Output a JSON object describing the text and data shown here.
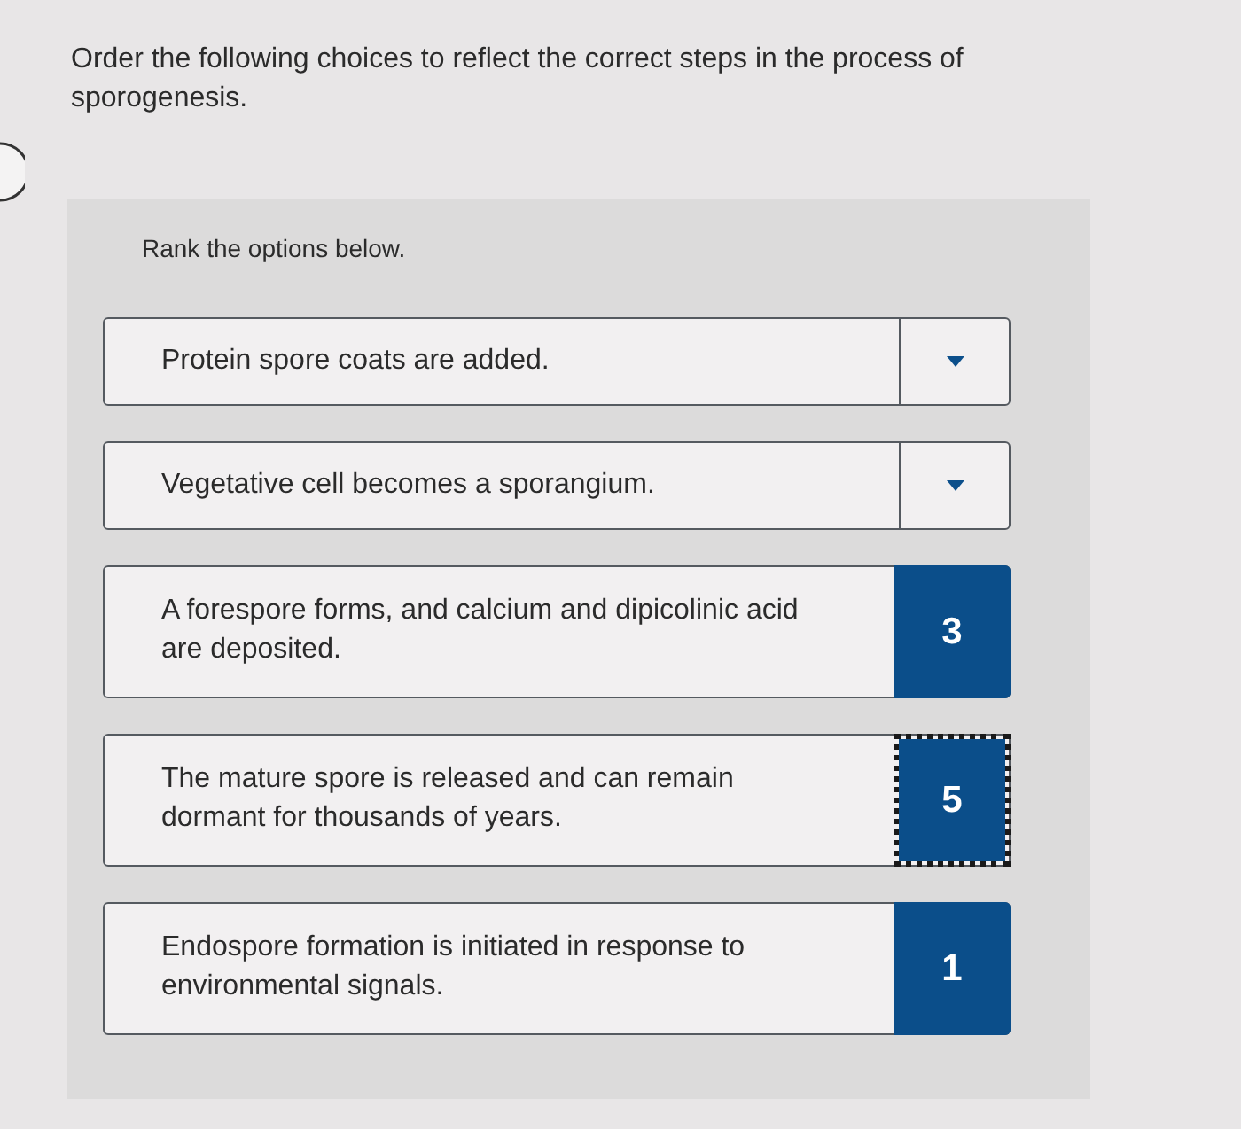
{
  "question": "Order the following choices to reflect the correct steps in the process of sporogenesis.",
  "panel": {
    "instruction": "Rank the options below.",
    "options": [
      {
        "text": "Protein spore coats are added.",
        "kind": "dropdown",
        "focused": false
      },
      {
        "text": "Vegetative cell becomes a sporangium.",
        "kind": "dropdown",
        "focused": false
      },
      {
        "text": "A forespore forms, and calcium and dipicolinic acid\nare deposited.",
        "kind": "rank",
        "rank": "3",
        "focused": false
      },
      {
        "text": "The mature spore is released and can remain\ndormant for thousands of years.",
        "kind": "rank",
        "rank": "5",
        "focused": true
      },
      {
        "text": "Endospore formation is initiated in response to\nenvironmental signals.",
        "kind": "rank",
        "rank": "1",
        "focused": false
      }
    ]
  }
}
